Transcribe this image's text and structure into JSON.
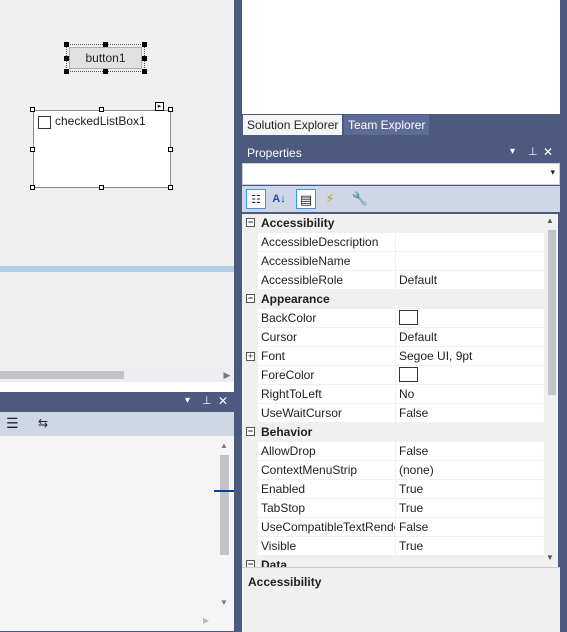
{
  "designer": {
    "button_label": "button1",
    "checked_list_label": "checkedListBox1"
  },
  "tabs": [
    "Solution Explorer",
    "Team Explorer"
  ],
  "properties": {
    "title": "Properties",
    "window_controls": [
      "▾",
      "⊥",
      "✕"
    ],
    "description_title": "Accessibility",
    "categories": [
      {
        "name": "Accessibility",
        "rows": [
          {
            "name": "AccessibleDescription",
            "value": ""
          },
          {
            "name": "AccessibleName",
            "value": ""
          },
          {
            "name": "AccessibleRole",
            "value": "Default"
          }
        ]
      },
      {
        "name": "Appearance",
        "rows": [
          {
            "name": "BackColor",
            "value": "",
            "swatch": "#ffffff"
          },
          {
            "name": "Cursor",
            "value": "Default"
          },
          {
            "name": "Font",
            "value": "Segoe UI, 9pt",
            "expandable": true
          },
          {
            "name": "ForeColor",
            "value": "",
            "swatch": "#ffffff"
          },
          {
            "name": "RightToLeft",
            "value": "No"
          },
          {
            "name": "UseWaitCursor",
            "value": "False"
          }
        ]
      },
      {
        "name": "Behavior",
        "rows": [
          {
            "name": "AllowDrop",
            "value": "False"
          },
          {
            "name": "ContextMenuStrip",
            "value": "(none)"
          },
          {
            "name": "Enabled",
            "value": "True"
          },
          {
            "name": "TabStop",
            "value": "True"
          },
          {
            "name": "UseCompatibleTextRende",
            "value": "False"
          },
          {
            "name": "Visible",
            "value": "True"
          }
        ]
      },
      {
        "name": "Data",
        "rows": []
      }
    ]
  },
  "colors": {
    "frame": "#4d5a7f",
    "toolbar": "#cfd6e5"
  },
  "icons": [
    "categorized-icon",
    "alphabetical-icon",
    "properties-icon",
    "events-icon",
    "property-pages-icon"
  ]
}
